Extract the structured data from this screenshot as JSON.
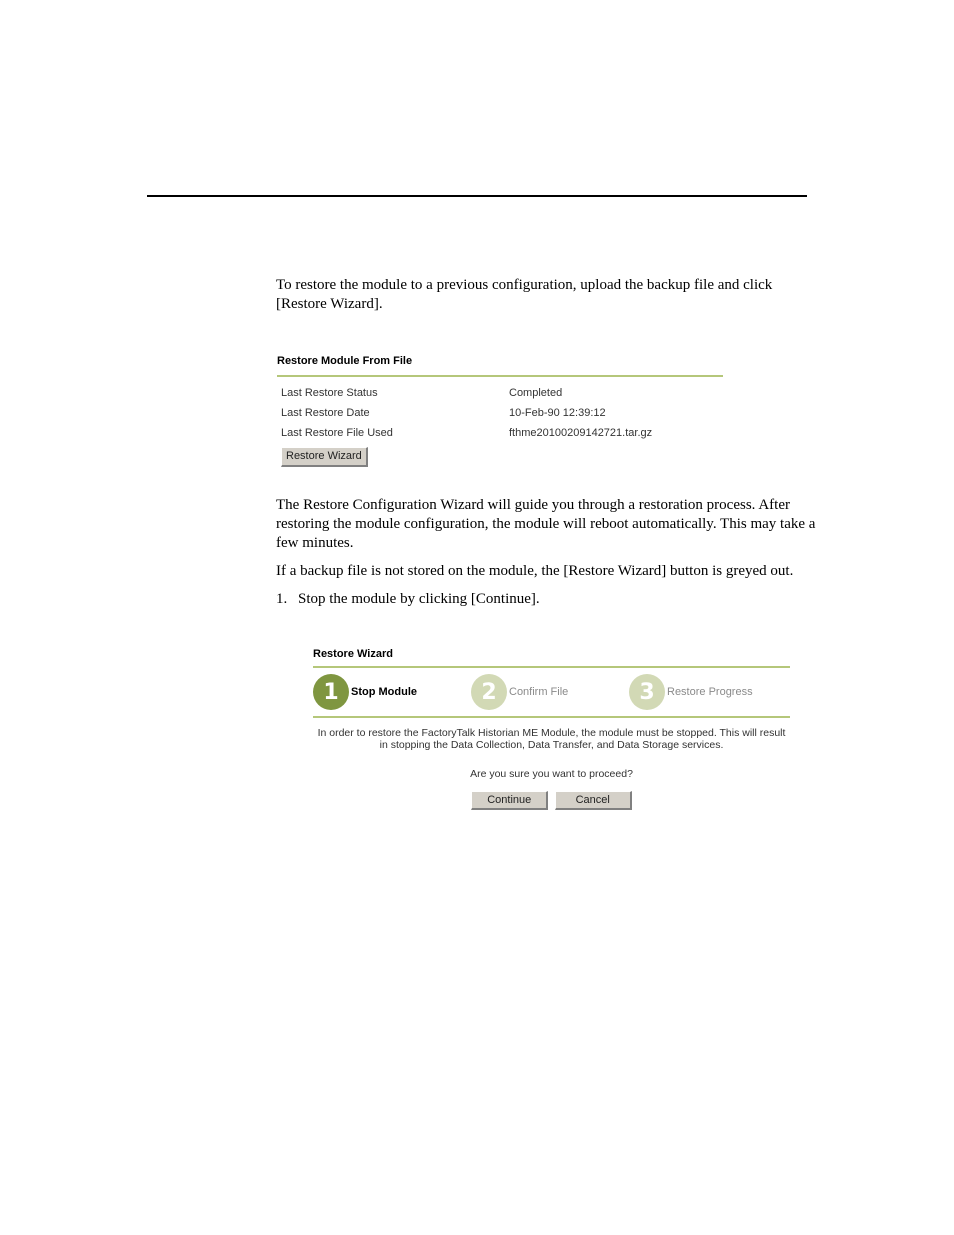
{
  "document": {
    "intro_text": "To restore the module to a previous configuration, upload the backup file and click [Restore Wizard].",
    "wizard_description": "The Restore Configuration Wizard will guide you through a restoration process. After restoring the module configuration, the module will reboot automatically. This may take a few minutes.",
    "greyed_note": "If a backup file is not stored on the module, the [Restore Wizard] button is greyed out.",
    "step1": {
      "number": "1.",
      "text": "Stop the module by clicking [Continue]."
    }
  },
  "restore_panel": {
    "title": "Restore Module From File",
    "rows": [
      {
        "label": "Last Restore Status",
        "value": "Completed"
      },
      {
        "label": "Last Restore Date",
        "value": "10-Feb-90 12:39:12"
      },
      {
        "label": "Last Restore File Used",
        "value": "fthme20100209142721.tar.gz"
      }
    ],
    "button_label": "Restore Wizard"
  },
  "wizard_panel": {
    "title": "Restore Wizard",
    "steps": [
      {
        "number": "1",
        "label": "Stop Module",
        "active": true
      },
      {
        "number": "2",
        "label": "Confirm File",
        "active": false
      },
      {
        "number": "3",
        "label": "Restore Progress",
        "active": false
      }
    ],
    "message": "In order to restore the FactoryTalk Historian ME Module, the module must be stopped.  This will result in stopping the Data Collection, Data Transfer, and Data Storage services.",
    "question": "Are you sure you want to proceed?",
    "continue_label": "Continue",
    "cancel_label": "Cancel",
    "colors": {
      "active": "#7f9640",
      "inactive": "#d2d9b5",
      "rule": "#b5c77a"
    }
  }
}
